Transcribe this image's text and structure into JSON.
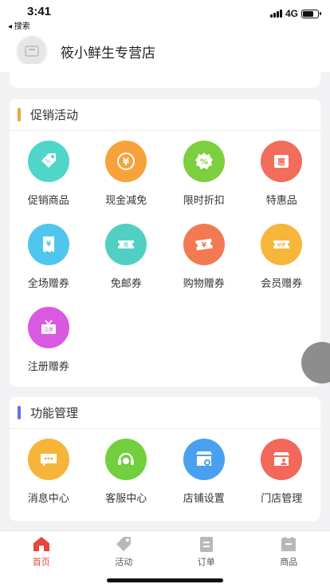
{
  "status_bar": {
    "time": "3:41",
    "back_label": "◂ 搜索",
    "network": "4G"
  },
  "header": {
    "store_name": "筱小鲜生专营店"
  },
  "promo": {
    "title": "促销活动",
    "accent_color": "#f0a43a",
    "items": [
      {
        "label": "促销商品",
        "icon": "tag-icon",
        "color": "#4fd6c8"
      },
      {
        "label": "现金减免",
        "icon": "yen-coin-icon",
        "color": "#f7a23b"
      },
      {
        "label": "限时折扣",
        "icon": "discount-icon",
        "color": "#7ccf3e"
      },
      {
        "label": "特惠品",
        "icon": "special-offer-icon",
        "color": "#f26d5b"
      },
      {
        "label": "全场赠券",
        "icon": "receipt-icon",
        "color": "#4fc6ee"
      },
      {
        "label": "免邮券",
        "icon": "free-shipping-ticket-icon",
        "color": "#52cfc3"
      },
      {
        "label": "购物赠券",
        "icon": "shopping-ticket-icon",
        "color": "#f27a52"
      },
      {
        "label": "会员赠券",
        "icon": "vip-ticket-icon",
        "color": "#f7b53a"
      },
      {
        "label": "注册赠券",
        "icon": "register-gift-icon",
        "color": "#d95ae0"
      }
    ]
  },
  "functions": {
    "title": "功能管理",
    "accent_color": "#6a6ee8",
    "items": [
      {
        "label": "消息中心",
        "icon": "message-icon",
        "color": "#f7b43a"
      },
      {
        "label": "客服中心",
        "icon": "customer-service-icon",
        "color": "#72cf3e"
      },
      {
        "label": "店铺设置",
        "icon": "store-settings-icon",
        "color": "#4aa0f0"
      },
      {
        "label": "门店管理",
        "icon": "store-manage-icon",
        "color": "#f2685b"
      }
    ]
  },
  "tabbar": {
    "active_color": "#e8453c",
    "items": [
      {
        "label": "首页",
        "icon": "home-icon"
      },
      {
        "label": "活动",
        "icon": "tag-icon"
      },
      {
        "label": "订单",
        "icon": "order-icon"
      },
      {
        "label": "商品",
        "icon": "product-icon"
      }
    ]
  }
}
